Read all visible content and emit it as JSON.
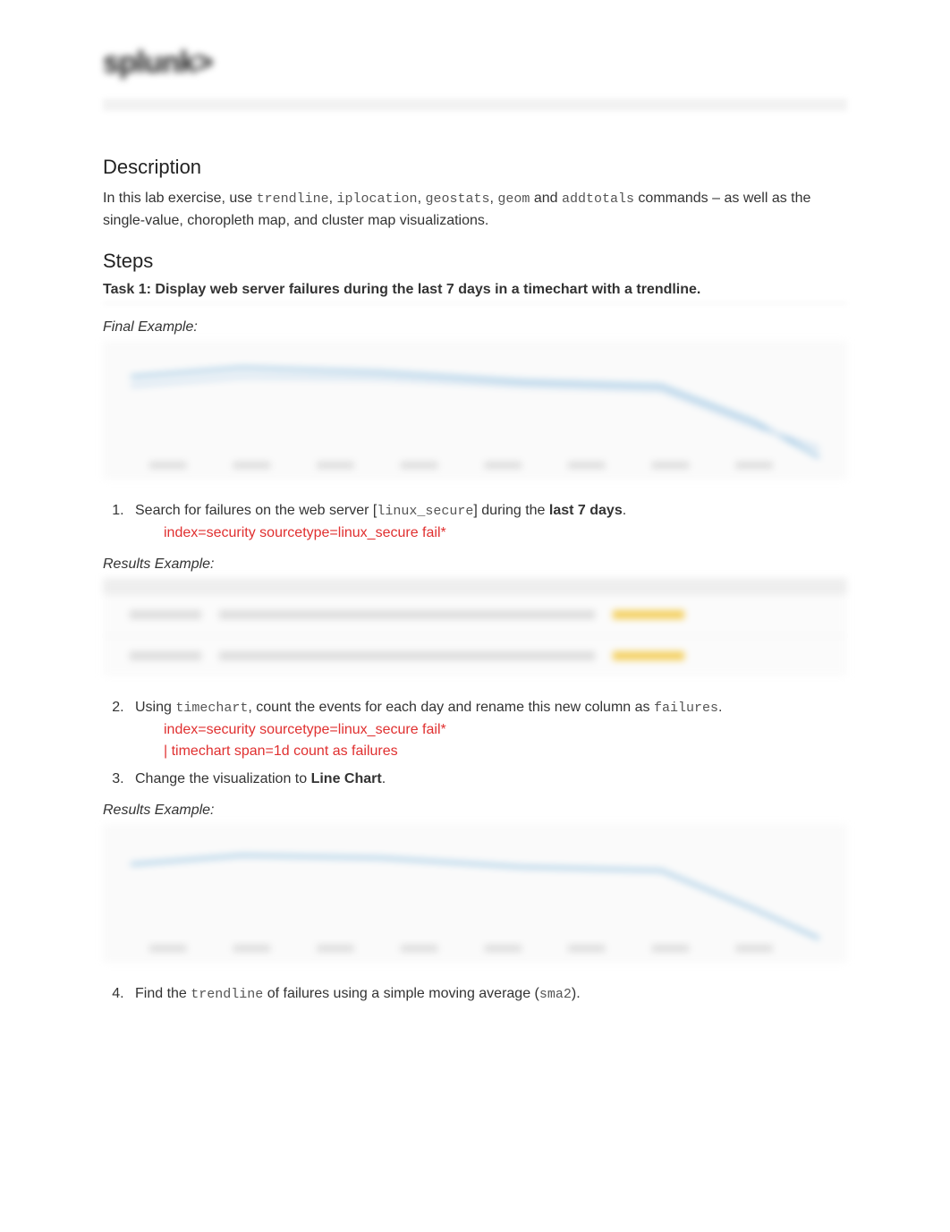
{
  "logo_text": "splunk>",
  "headings": {
    "description": "Description",
    "steps": "Steps"
  },
  "description_parts": {
    "pre": "In this lab exercise, use ",
    "c1": "trendline",
    "c2": "iplocation",
    "c3": "geostats",
    "c4": "geom",
    "c5": "addtotals",
    "sep": ", ",
    "and": " and ",
    "post": " commands – as well as the single-value, choropleth map, and cluster map visualizations."
  },
  "task1_title": "Task 1: Display web server failures during the last 7 days in a timechart with a trendline.",
  "labels": {
    "final_example": "Final Example:",
    "results_example": "Results Example:"
  },
  "step1": {
    "pre": "Search for failures on the web server [",
    "code": "linux_secure",
    "mid": "] during the ",
    "bold": "last 7 days",
    "post": ".",
    "query": "index=security sourcetype=linux_secure fail*"
  },
  "step2": {
    "pre": "Using ",
    "code1": "timechart",
    "mid": ", count the events for each day and rename this new column as ",
    "code2": "failures",
    "post": ".",
    "query_l1": "index=security sourcetype=linux_secure fail*",
    "query_l2": "| timechart span=1d count as failures"
  },
  "step3": {
    "pre": "Change the visualization to ",
    "bold": "Line Chart",
    "post": "."
  },
  "step4": {
    "pre": "Find the ",
    "code1": "trendline",
    "mid": " of failures using a simple moving average (",
    "code2": "sma2",
    "post": ")."
  }
}
